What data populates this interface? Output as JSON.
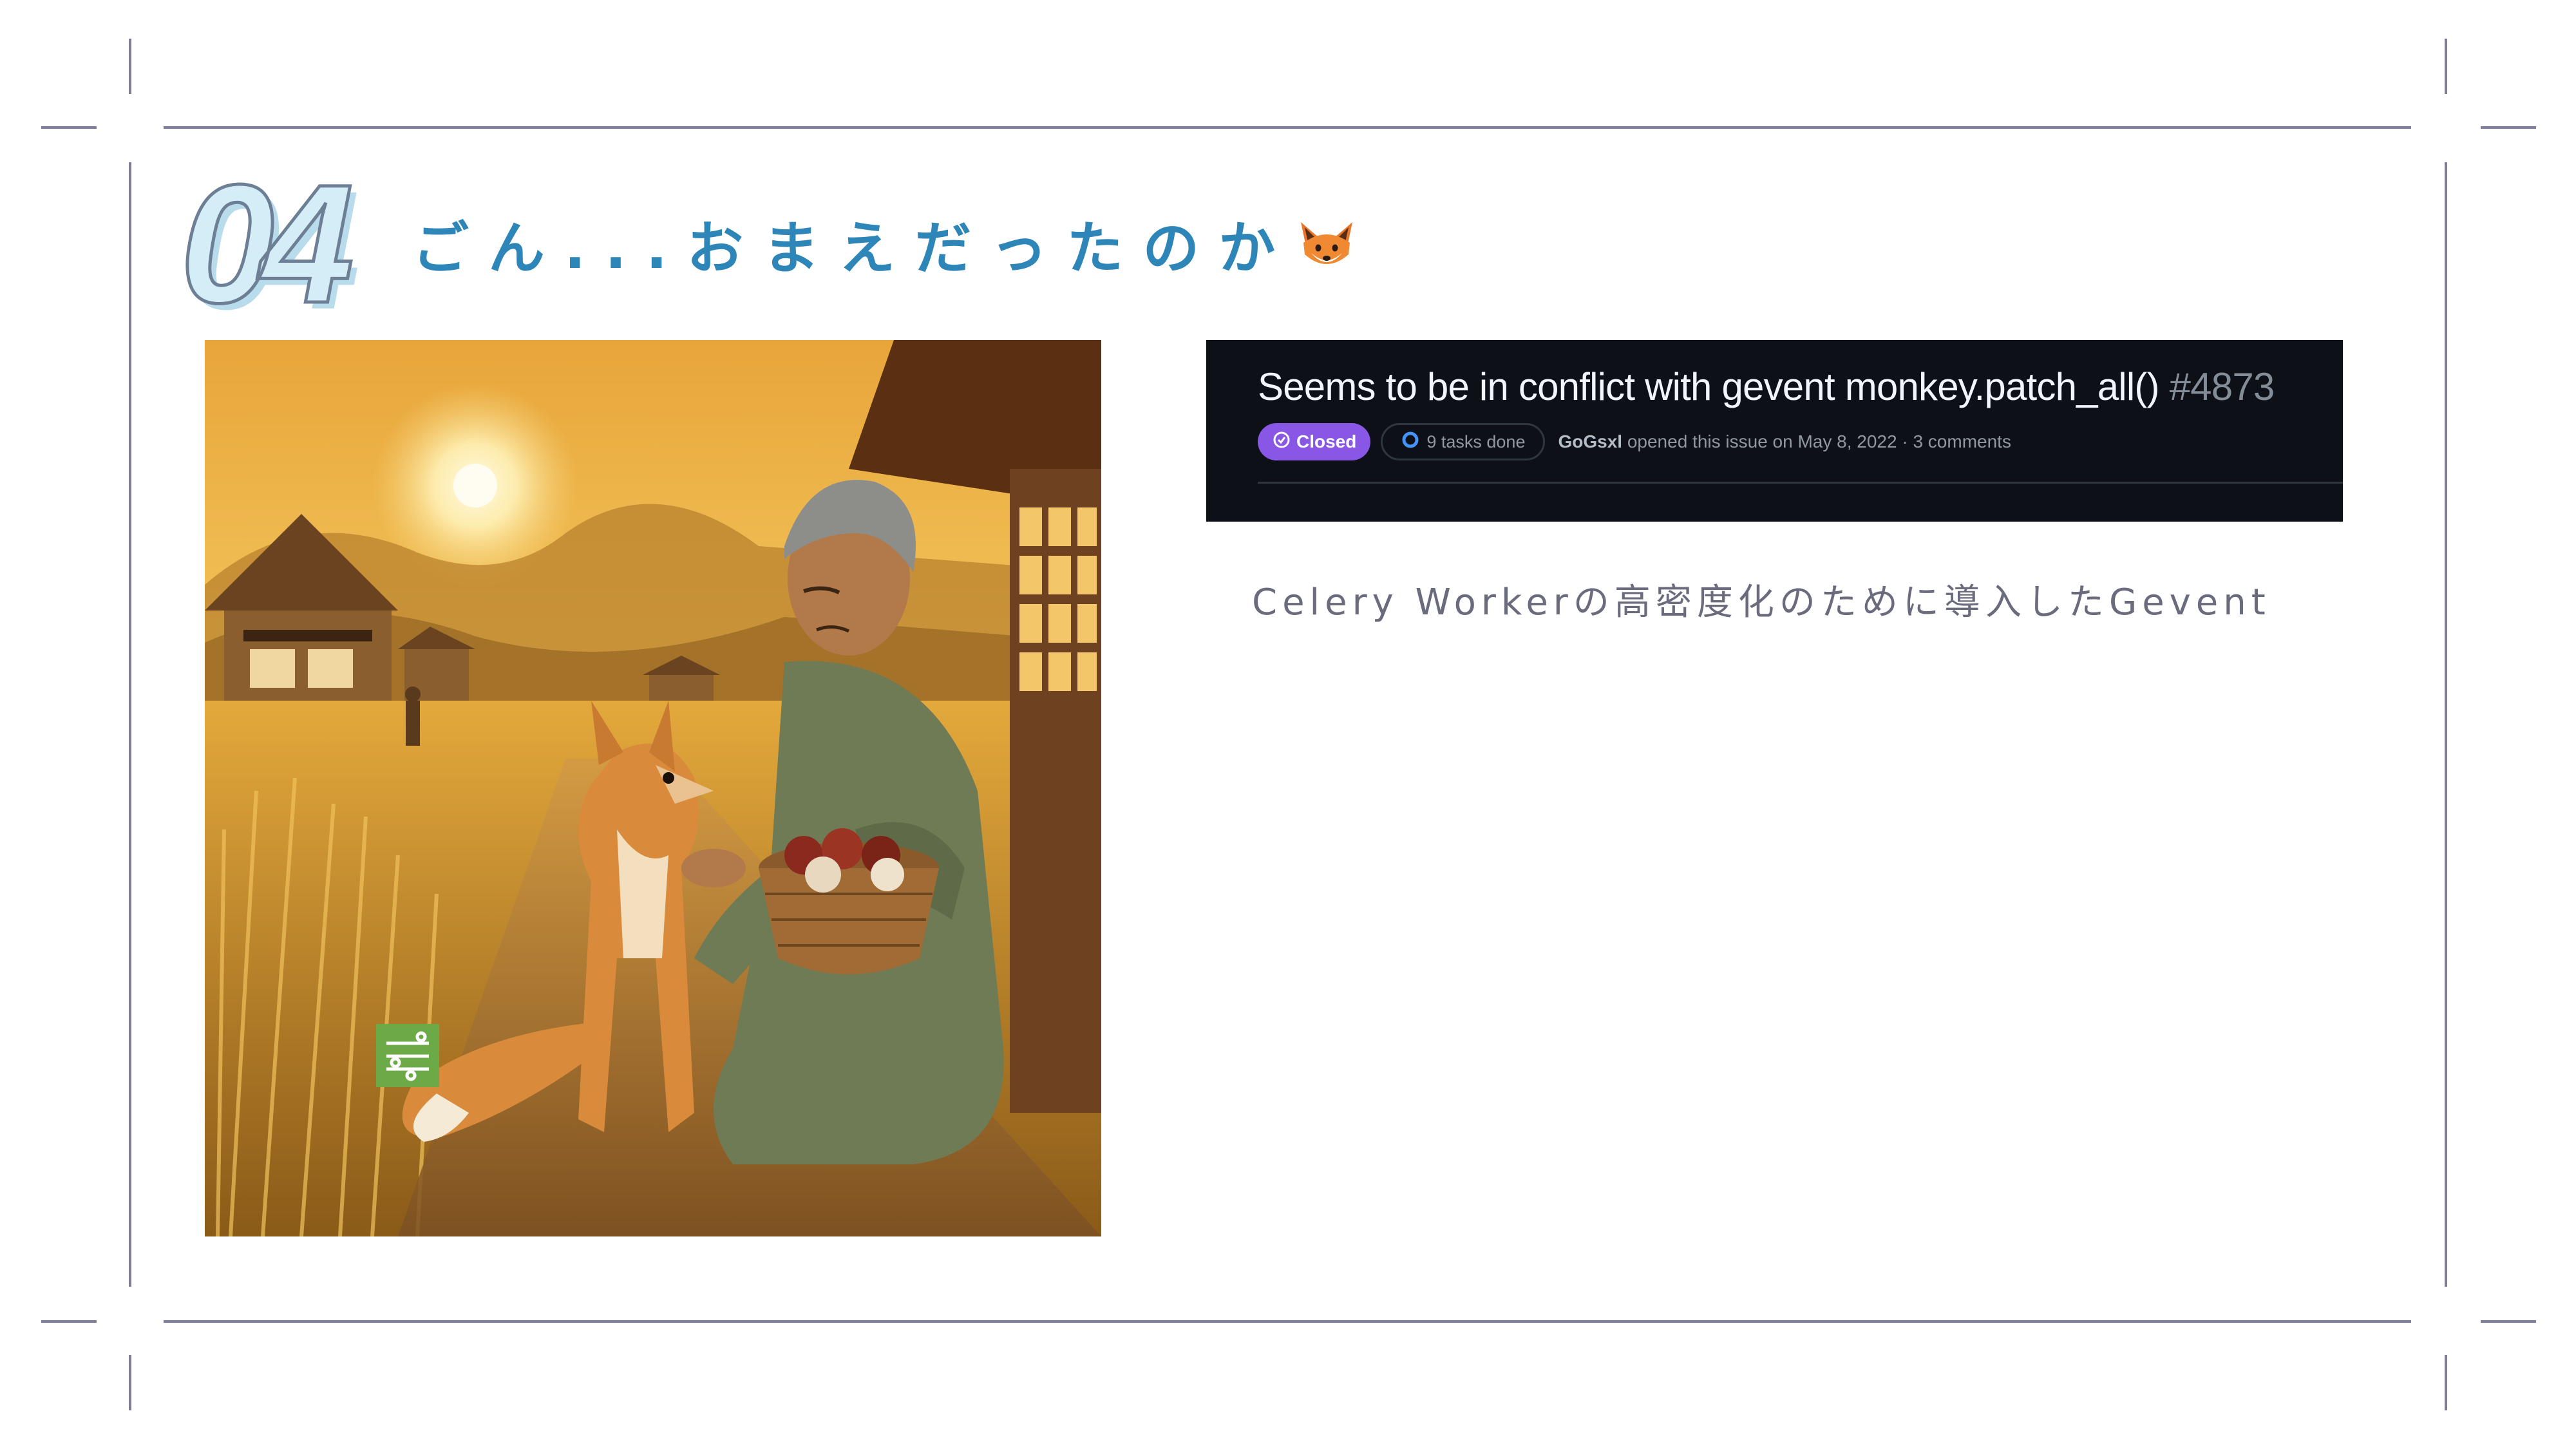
{
  "slide": {
    "section_number": "04",
    "title": "ごん...おまえだったのか",
    "title_icon": "fox-face-icon",
    "subtitle": "Celery Workerの高密度化のために導入したGevent"
  },
  "issue": {
    "title": "Seems to be in conflict with gevent monkey.patch_all()",
    "number": "#4873",
    "status": "Closed",
    "tasks": "9 tasks done",
    "author": "GoGsxl",
    "opened_text": "opened this issue on May 8, 2022 · 3 comments"
  },
  "colors": {
    "title": "#2e86b8",
    "badge_closed": "#8957e5",
    "issue_bg": "#0d1117",
    "frame_lines": "#7d7d9a"
  }
}
